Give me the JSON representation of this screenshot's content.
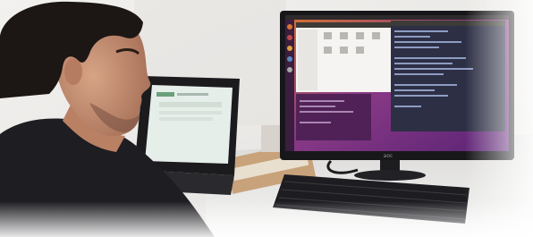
{
  "monitor": {
    "brand": "aoc"
  },
  "colors": {
    "wall": "#ebe9e6",
    "desk": "#e7e6e4",
    "ubuntu_purple": "#6a2a7a",
    "ubuntu_orange": "#d8742f",
    "terminal": "#2d2f45",
    "laptop_screen": "#e6eeea",
    "shirt": "#1e1d21",
    "hair": "#1c1614",
    "skin": "#c99273"
  }
}
